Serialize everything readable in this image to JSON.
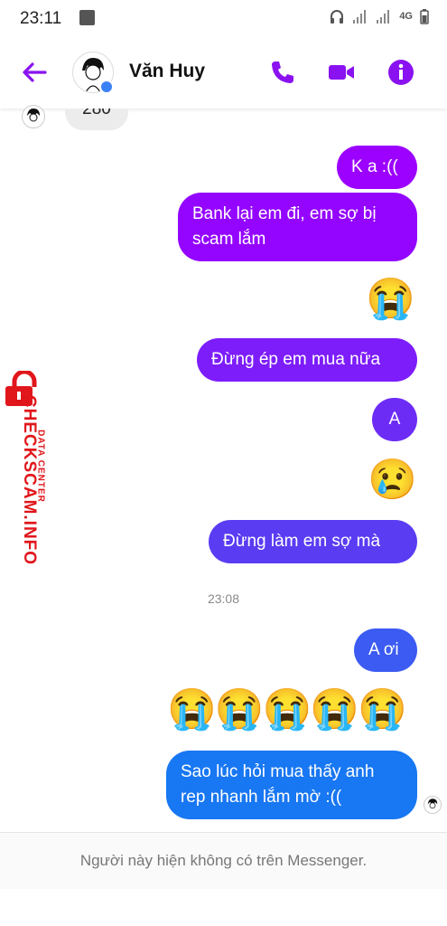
{
  "status_bar": {
    "time": "23:11",
    "network": "4G"
  },
  "header": {
    "contact_name": "Văn Huy"
  },
  "colors": {
    "accent": "#8a12f0"
  },
  "incoming_partial": "280",
  "messages": [
    {
      "text": "K a :(("
    },
    {
      "text": "Bank lại em đi, em sợ bị scam lắm"
    },
    {
      "emoji": "😭"
    },
    {
      "text": "Đừng ép em mua nữa"
    },
    {
      "text": "A"
    },
    {
      "emoji": "😢"
    },
    {
      "text": "Đừng làm em sợ mà"
    },
    {
      "timestamp": "23:08"
    },
    {
      "text": "A ơi"
    },
    {
      "emoji": "😭😭😭😭😭"
    },
    {
      "text": "Sao lúc hỏi mua thấy anh rep nhanh lắm mờ :(("
    }
  ],
  "footer_text": "Người này hiện không có trên Messenger.",
  "watermark": {
    "title": "CHECKSCAM.INFO",
    "subtitle": "DATA CENTER"
  }
}
